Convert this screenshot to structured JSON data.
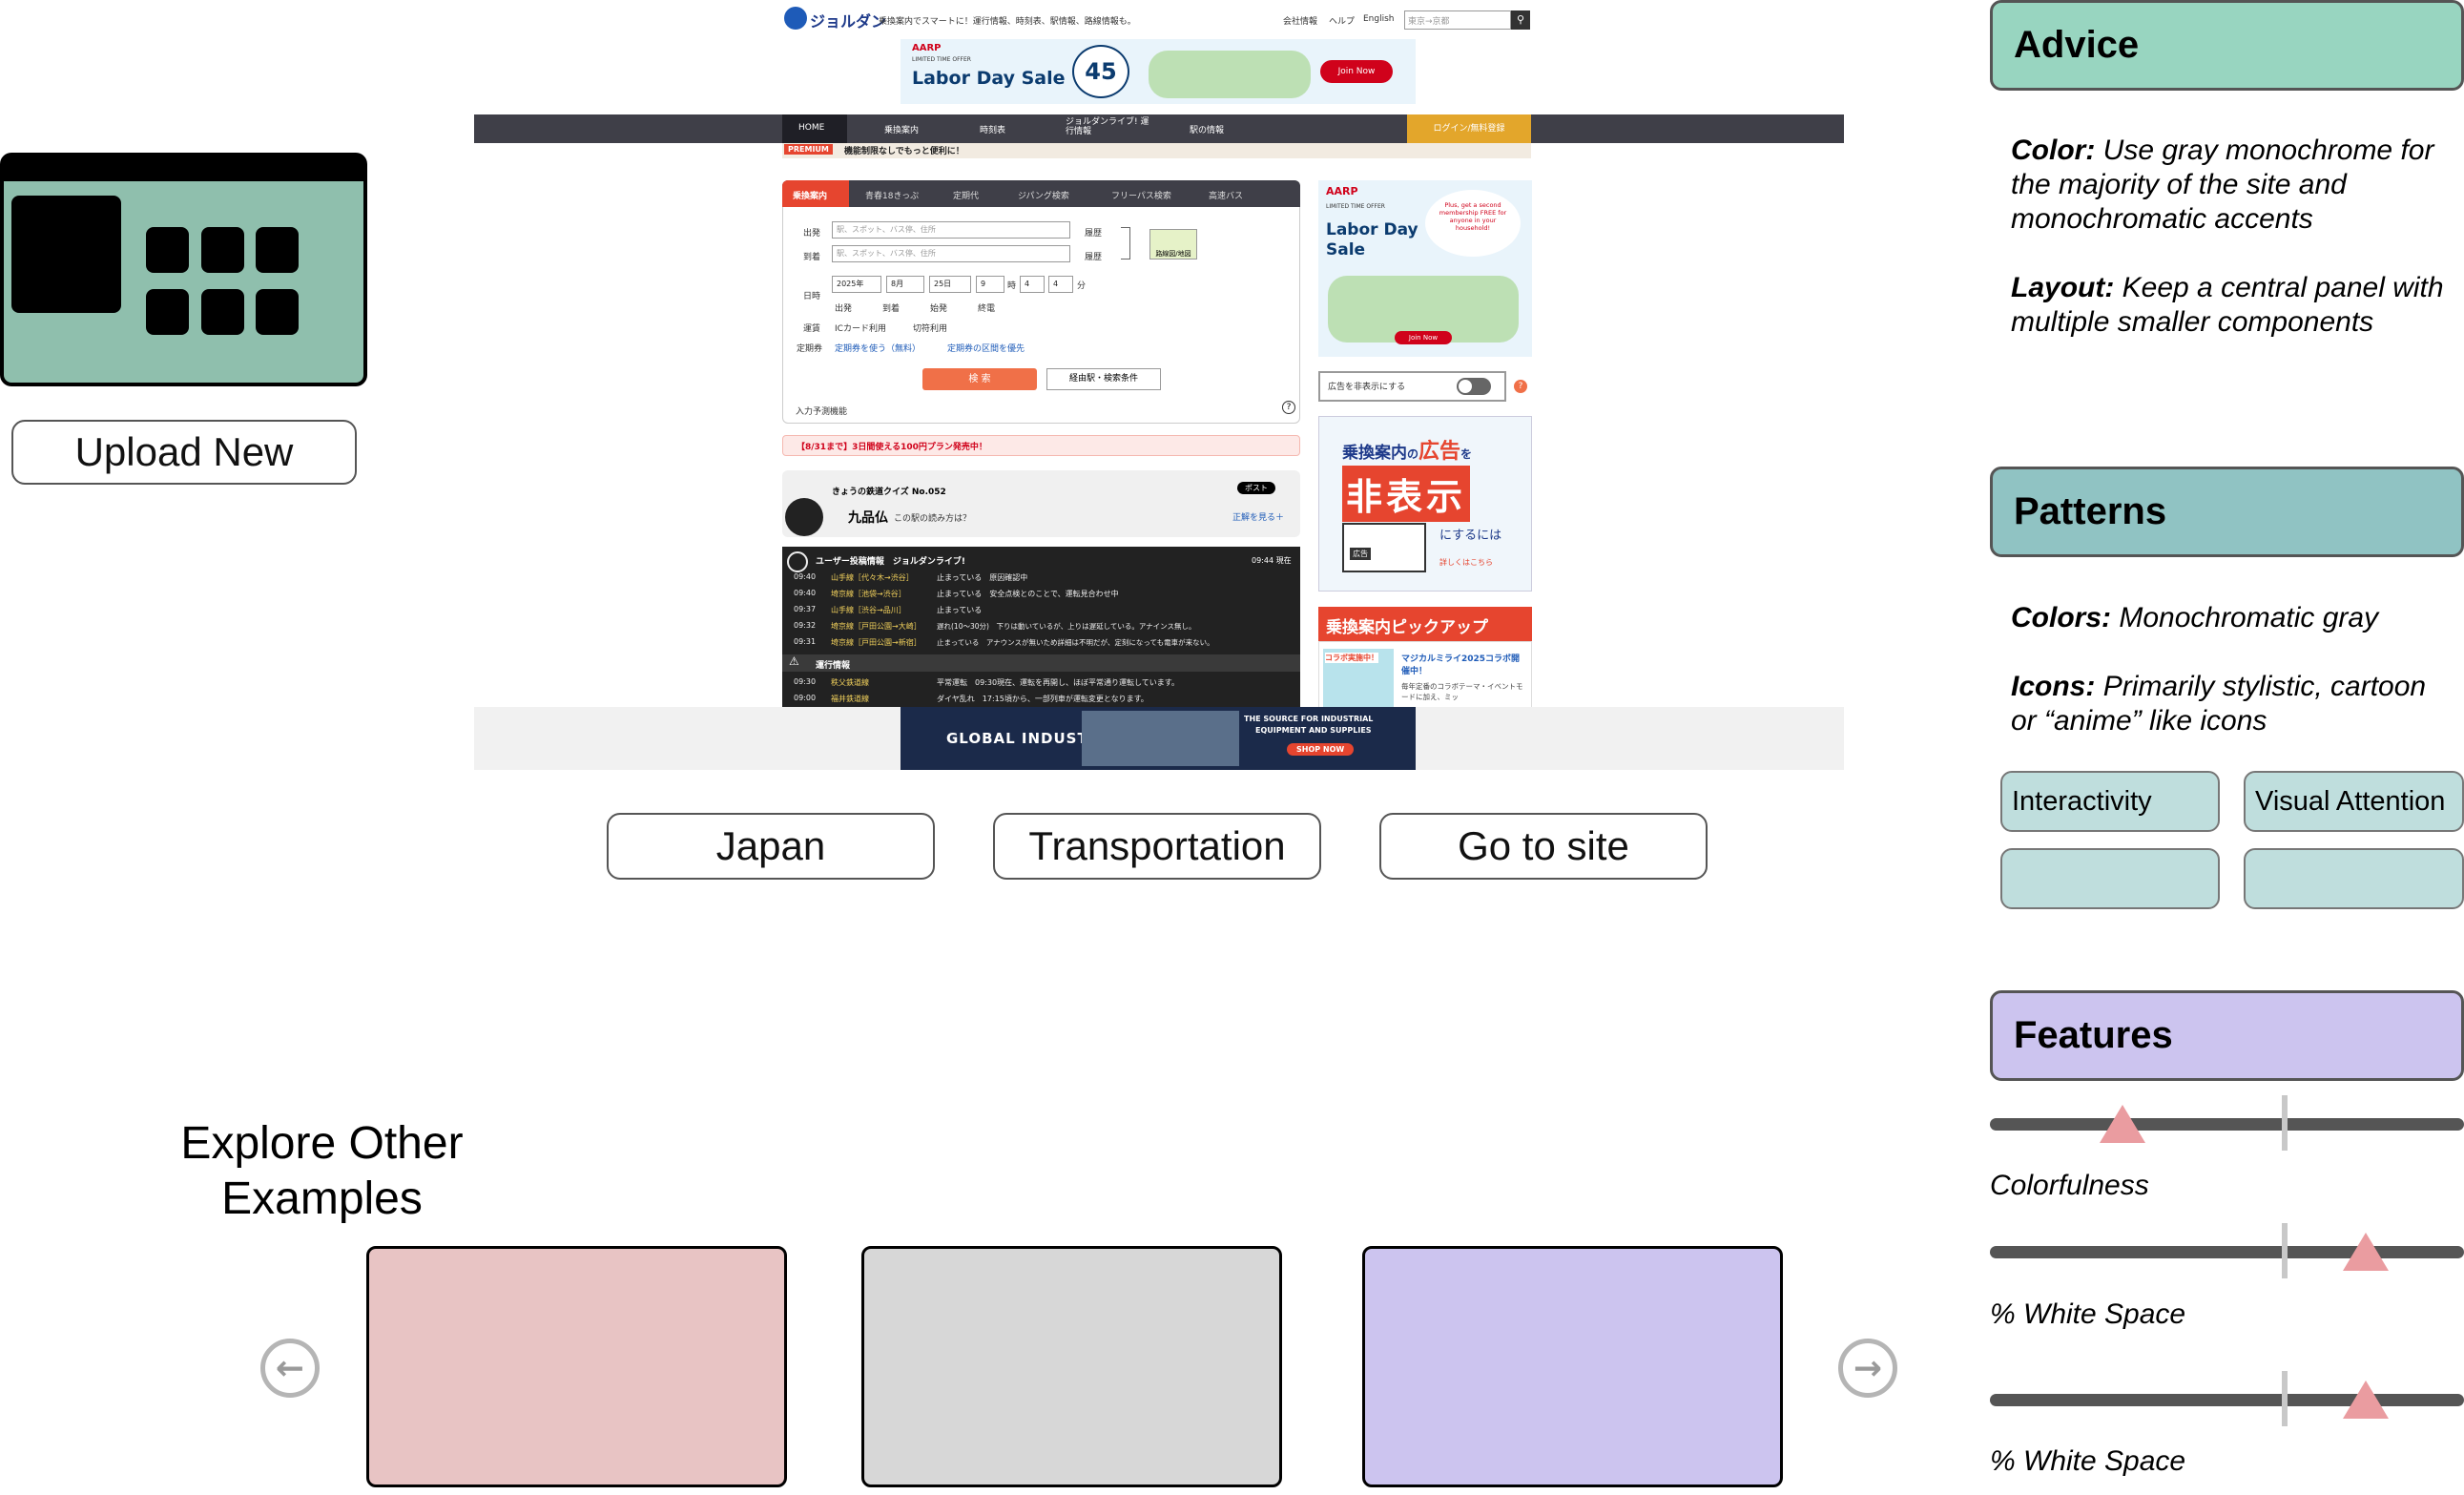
{
  "left": {
    "upload_label": "Upload New",
    "explore_line1": "Explore Other",
    "explore_line2": "Examples",
    "cards": [
      {
        "color": "#e8c4c4"
      },
      {
        "color": "#d7d7d7"
      },
      {
        "color": "#ccc4ef"
      }
    ],
    "prev_icon": "arrow-left-icon",
    "next_icon": "arrow-right-icon"
  },
  "tags": [
    "Japan",
    "Transportation",
    "Go to site"
  ],
  "right": {
    "advice": {
      "title": "Advice",
      "color_key": "Color:",
      "color_text": " Use gray monochrome for the majority of the site and monochromatic accents",
      "layout_key": "Layout:",
      "layout_text": " Keep a central panel with multiple smaller components"
    },
    "patterns": {
      "title": "Patterns",
      "colors_key": "Colors:",
      "colors_text": " Monochromatic gray",
      "icons_key": "Icons:",
      "icons_text": " Primarily stylistic, cartoon or “anime” like icons",
      "chips": [
        "Interactivity",
        "Visual Attention",
        "",
        ""
      ]
    },
    "features": {
      "title": "Features",
      "sliders": [
        {
          "label": "Colorfulness",
          "value": 0.15
        },
        {
          "label": "% White Space",
          "value": 0.81
        },
        {
          "label": "% White Space",
          "value": 0.81
        }
      ]
    },
    "colors": {
      "advice": "#98d5c0",
      "patterns": "#90c3c3",
      "features": "#ccc4ef"
    }
  },
  "shot": {
    "logo": "ジョルダン",
    "tagline": "乗換案内でスマートに！運行情報、時刻表、駅情報、路線情報も。",
    "top_links": [
      "会社情報",
      "ヘルプ",
      "English"
    ],
    "search_placeholder": "東京→京都",
    "ad1": {
      "brand": "AARP",
      "sub": "LIMITED TIME OFFER",
      "title": "Labor Day Sale",
      "pct": "45",
      "cta": "Join Now"
    },
    "nav": [
      "HOME",
      "乗換案内",
      "時刻表",
      "ジョルダンライブ! 運行情報",
      "駅の情報",
      "ログイン/無料登録"
    ],
    "premium_tag": "PREMIUM",
    "premium_text": "機能制限なしでもっと便利に！",
    "tabs": [
      "乗換案内",
      "青春18きっぷ",
      "定期代",
      "ジパング検索",
      "フリーパス検索",
      "高速バス"
    ],
    "form": {
      "from_label": "出発",
      "to_label": "到着",
      "placeholder": "駅、スポット、バス停、住所",
      "history": "履歴",
      "route_map": "路線図/地図",
      "date_label": "日時",
      "year": "2025年",
      "month": "8月",
      "day": "25日",
      "hour": "9",
      "min1": "4",
      "min2": "4",
      "min_unit": "分",
      "hour_unit": "時",
      "time_opts": [
        "出発",
        "到着",
        "始発",
        "終電"
      ],
      "fare_label": "運賃",
      "fare_opts": [
        "ICカード利用",
        "切符利用"
      ],
      "pass_label": "定期券",
      "pass_opts": [
        "定期券を使う（無料）",
        "定期券の区間を優先"
      ],
      "search_btn": "検 索",
      "cond_btn": "経由駅・検索条件",
      "predict": "入力予測機能"
    },
    "notice": "【8/31まで】3日間使える100円プラン発売中！",
    "quiz": {
      "title": "きょうの鉄道クイズ No.052",
      "word": "九品仏",
      "q": "この駅の読み方は？",
      "post": "ポスト",
      "answer": "正解を見る＋"
    },
    "feed": {
      "title": "ユーザー投稿情報　ジョルダンライブ!",
      "time": "09:44 現在",
      "rows": [
        {
          "t": "09:40",
          "line": "山手線［代々木→渋谷］",
          "msg": "止まっている　原因確認中"
        },
        {
          "t": "09:40",
          "line": "埼京線［池袋→渋谷］",
          "msg": "止まっている　安全点検とのことで、運転見合わせ中"
        },
        {
          "t": "09:37",
          "line": "山手線［渋谷→品川］",
          "msg": "止まっている"
        },
        {
          "t": "09:32",
          "line": "埼京線［戸田公園→大崎］",
          "msg": "遅れ(10〜30分)　下りは動いているが、上りは遅延している。アナインス無し。"
        },
        {
          "t": "09:31",
          "line": "埼京線［戸田公園→新宿］",
          "msg": "止まっている　アナウンスが無いため詳細は不明だが、定刻になっても電車が来ない。"
        }
      ],
      "ops_title": "運行情報",
      "ops": [
        {
          "t": "09:30",
          "line": "秩父鉄道線",
          "msg": "平常運転　09:30現在、運転を再開し、ほぼ平常通り運転しています。"
        },
        {
          "t": "09:00",
          "line": "福井鉄道線",
          "msg": "ダイヤ乱れ　17:15頃から、一部列車が運転変更となります。"
        }
      ]
    },
    "side_ad": {
      "brand": "AARP",
      "sub": "LIMITED TIME OFFER",
      "title": "Labor Day Sale",
      "bubble": "Plus, get a second membership FREE for anyone in your household!",
      "cta": "Join Now"
    },
    "toggle_label": "広告を非表示にする",
    "hide_ad": {
      "l1": "乗換案内",
      "l2": "の",
      "l3": "広告",
      "l4": "を",
      "big": "非表示",
      "l5": "にするには",
      "link": "詳しくはこちら",
      "badge": "広告"
    },
    "pickup": {
      "title": "乗換案内ピックアップ",
      "tag": "コラボ実施中！",
      "head": "マジカルミライ2025コラボ開催中！",
      "body": "毎年定番のコラボテーマ・イベントモードに加え、ミッ"
    },
    "bottom_ad": {
      "brand": "GLOBAL INDUSTRIAL",
      "l1": "THE SOURCE FOR INDUSTRIAL",
      "l2": "EQUIPMENT AND SUPPLIES",
      "cta": "SHOP NOW"
    }
  }
}
